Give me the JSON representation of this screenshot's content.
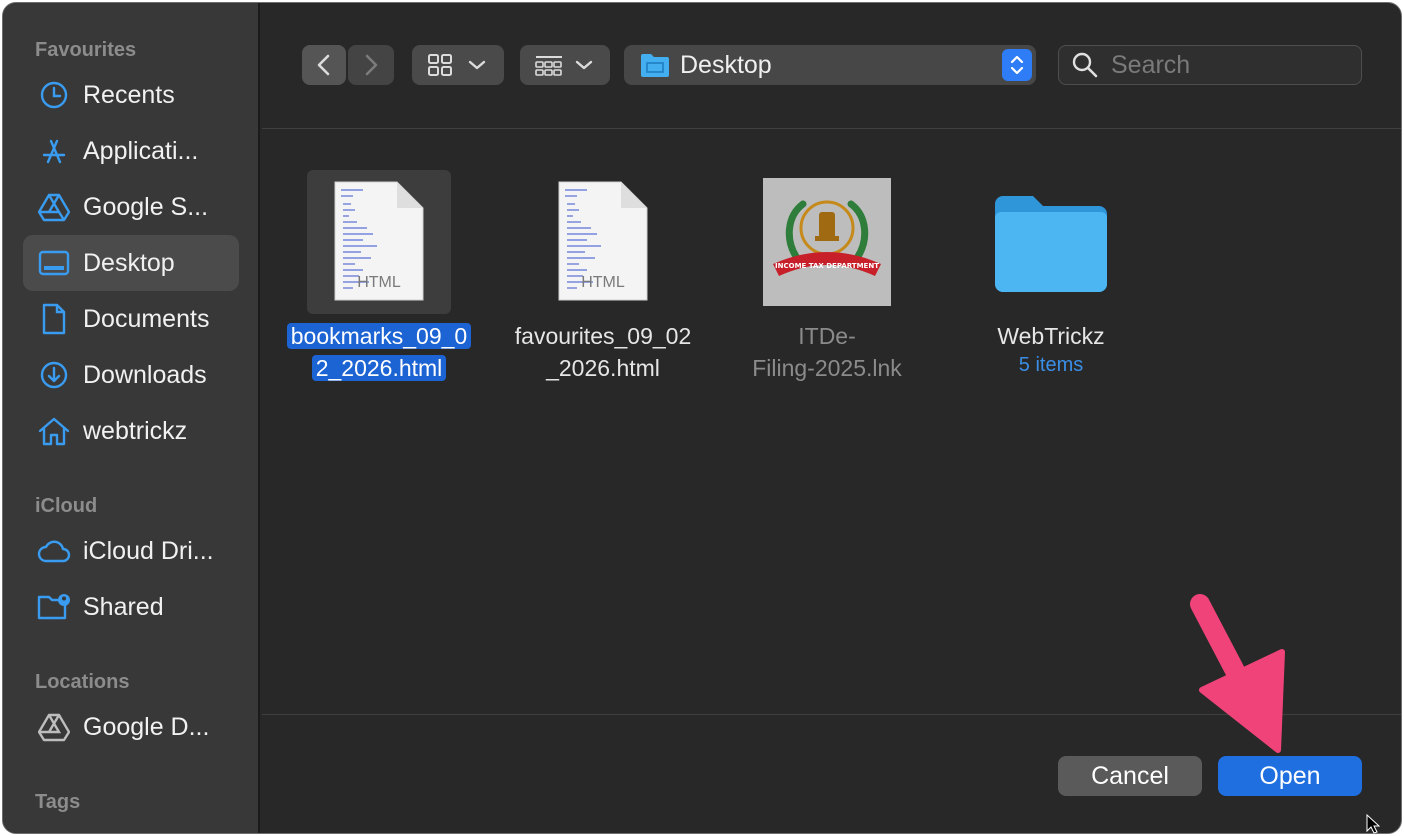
{
  "sidebar": {
    "sections": {
      "favourites": "Favourites",
      "icloud": "iCloud",
      "locations": "Locations",
      "tags": "Tags"
    },
    "items": [
      {
        "label": "Recents",
        "icon": "clock-icon"
      },
      {
        "label": "Applicati...",
        "icon": "applications-icon"
      },
      {
        "label": "Google S...",
        "icon": "google-drive-icon"
      },
      {
        "label": "Desktop",
        "icon": "desktop-icon"
      },
      {
        "label": "Documents",
        "icon": "document-icon"
      },
      {
        "label": "Downloads",
        "icon": "download-icon"
      },
      {
        "label": "webtrickz",
        "icon": "home-icon"
      },
      {
        "label": "iCloud Dri...",
        "icon": "cloud-icon"
      },
      {
        "label": "Shared",
        "icon": "shared-folder-icon"
      },
      {
        "label": "Google D...",
        "icon": "google-drive-icon"
      }
    ],
    "active": "Desktop"
  },
  "toolbar": {
    "path": "Desktop",
    "search_placeholder": "Search"
  },
  "files": [
    {
      "name_line1": "bookmarks_09_0",
      "name_line2": "2_2026.html",
      "badge": "HTML",
      "selected": true
    },
    {
      "name_line1": "favourites_09_02",
      "name_line2": "_2026.html",
      "badge": "HTML",
      "selected": false
    },
    {
      "name_line1": "ITDe-",
      "name_line2": "Filing-2025.lnk",
      "seal_text": "INCOME TAX DEPARTMENT",
      "selected": false
    },
    {
      "name_line1": "WebTrickz",
      "sub": "5 items",
      "selected": false
    }
  ],
  "buttons": {
    "cancel": "Cancel",
    "open": "Open"
  },
  "colors": {
    "accent": "#1f6fe0",
    "folder": "#3aa9ea",
    "annotation_arrow": "#f0437a"
  }
}
